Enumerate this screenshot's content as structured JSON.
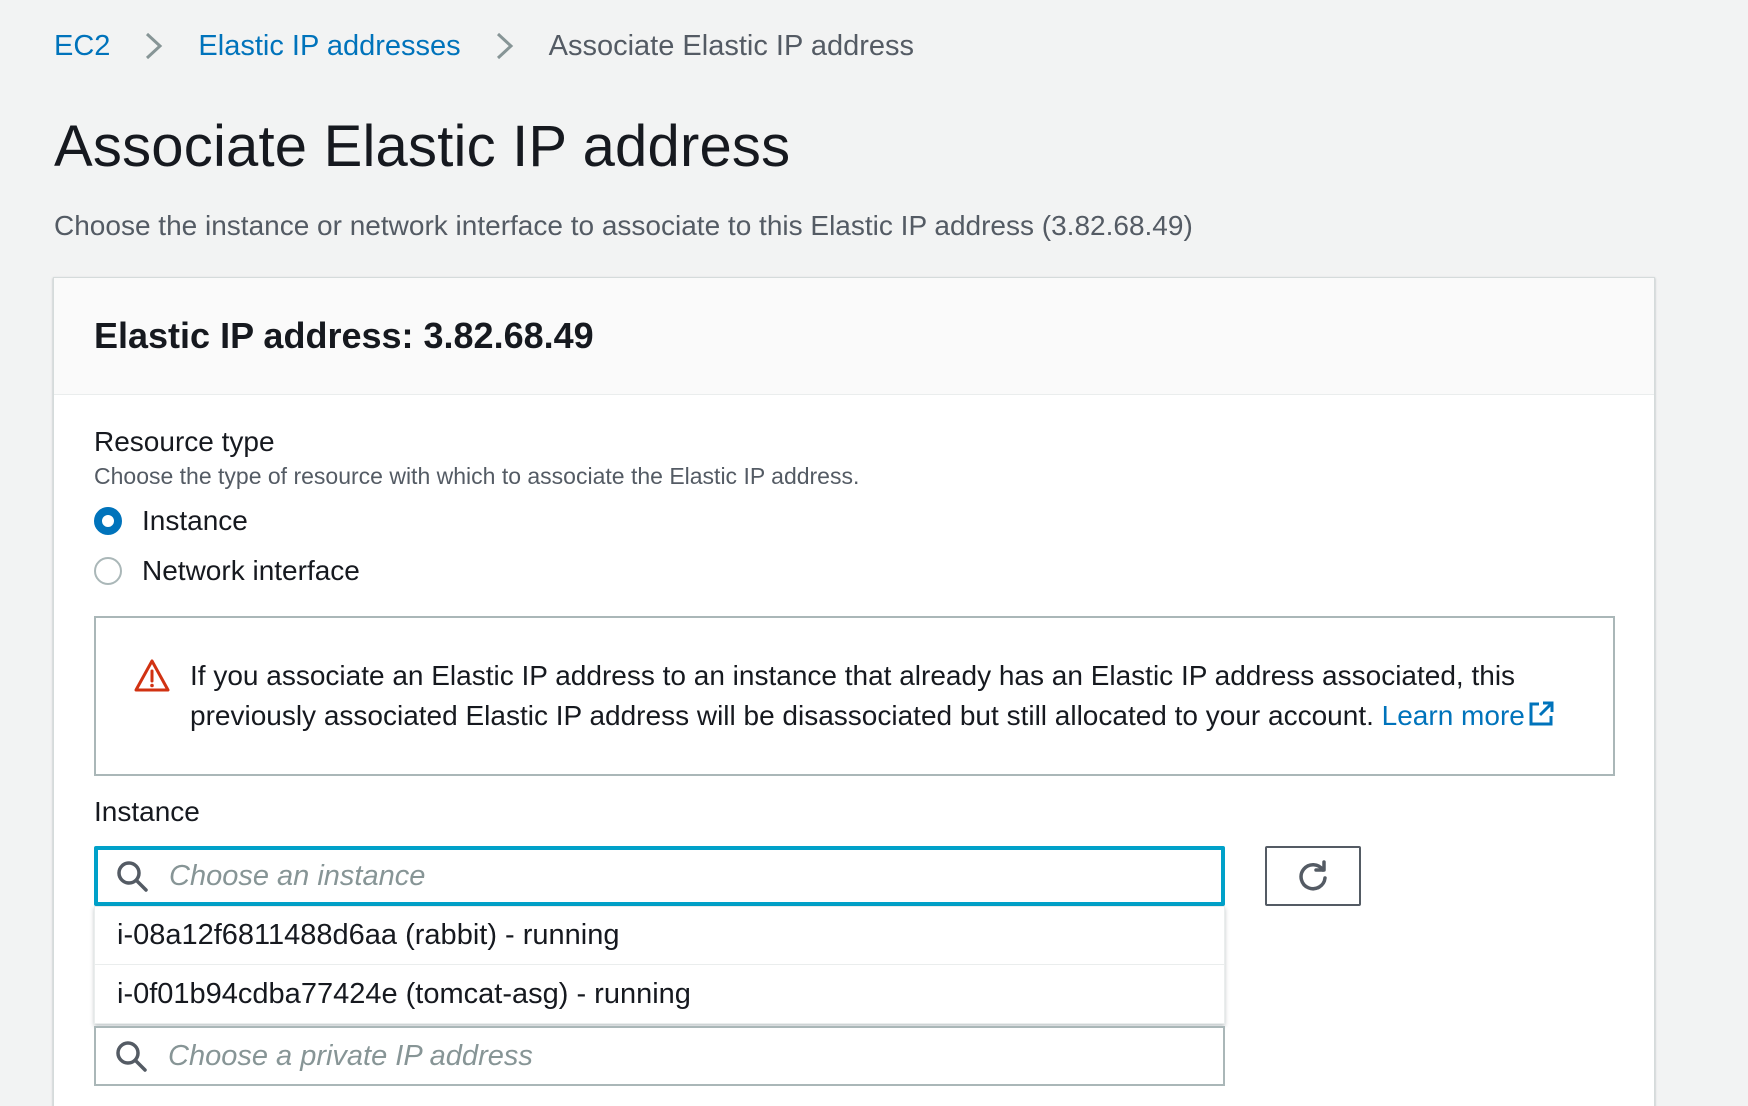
{
  "breadcrumb": {
    "items": [
      {
        "label": "EC2"
      },
      {
        "label": "Elastic IP addresses"
      }
    ],
    "current": "Associate Elastic IP address"
  },
  "page": {
    "title": "Associate Elastic IP address",
    "description": "Choose the instance or network interface to associate to this Elastic IP address (3.82.68.49)"
  },
  "card": {
    "title": "Elastic IP address: 3.82.68.49"
  },
  "resource_type": {
    "label": "Resource type",
    "description": "Choose the type of resource with which to associate the Elastic IP address.",
    "options": [
      {
        "label": "Instance",
        "checked": true
      },
      {
        "label": "Network interface",
        "checked": false
      }
    ]
  },
  "alert": {
    "text_line1": "If you associate an Elastic IP address to an instance that already has an Elastic IP address associated, this",
    "text_line2": "previously associated Elastic IP address will be disassociated but still allocated to your account.",
    "link_label": "Learn more"
  },
  "instance": {
    "label": "Instance",
    "placeholder": "Choose an instance",
    "options": [
      "i-08a12f6811488d6aa (rabbit) - running",
      "i-0f01b94cdba77424e (tomcat-asg) - running"
    ]
  },
  "private_ip": {
    "placeholder": "Choose a private IP address"
  },
  "colors": {
    "link": "#0073bb",
    "focus": "#00a1c9",
    "warning": "#d13212"
  },
  "icons": {
    "breadcrumb_separator": "chevron-right-icon",
    "alert": "warning-icon",
    "external": "external-link-icon",
    "search": "search-icon",
    "refresh": "refresh-icon"
  }
}
